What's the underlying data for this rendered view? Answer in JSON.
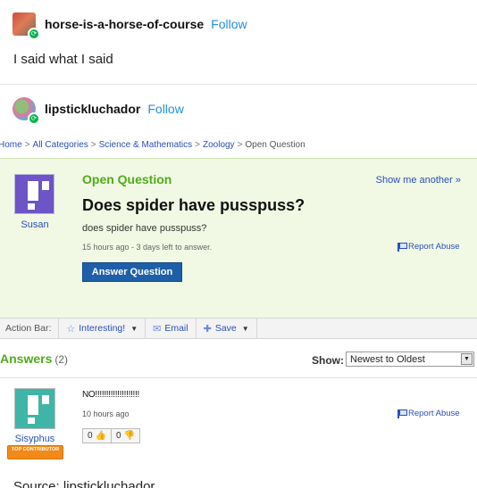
{
  "post1": {
    "username": "horse-is-a-horse-of-course",
    "follow_label": "Follow",
    "text": "I said what I said"
  },
  "post2": {
    "username": "lipstickluchador",
    "follow_label": "Follow"
  },
  "yahoo": {
    "breadcrumb": [
      "Home",
      "All Categories",
      "Science & Mathematics",
      "Zoology",
      "Open Question"
    ],
    "breadcrumb_sep": ">",
    "question": {
      "status": "Open Question",
      "show_another": "Show me another »",
      "title": "Does spider have pusspuss?",
      "body": "does spider have pusspuss?",
      "meta": "15 hours ago - 3 days left to answer.",
      "report_label": "Report Abuse",
      "answer_button": "Answer Question",
      "asker": "Susan"
    },
    "action_bar": {
      "label": "Action Bar:",
      "interesting": "Interesting!",
      "email": "Email",
      "save": "Save"
    },
    "answers": {
      "heading": "Answers",
      "count": "(2)",
      "show_label": "Show:",
      "sort_value": "Newest to Oldest",
      "items": [
        {
          "author": "Sisyphus",
          "badge": "TOP CONTRIBUTOR",
          "text": "NO!!!!!!!!!!!!!!!!!!!!",
          "time": "10 hours ago",
          "report_label": "Report Abuse",
          "thumbs_up": "0",
          "thumbs_down": "0"
        }
      ]
    }
  },
  "trailing_text": "Source: lipstickluchador"
}
